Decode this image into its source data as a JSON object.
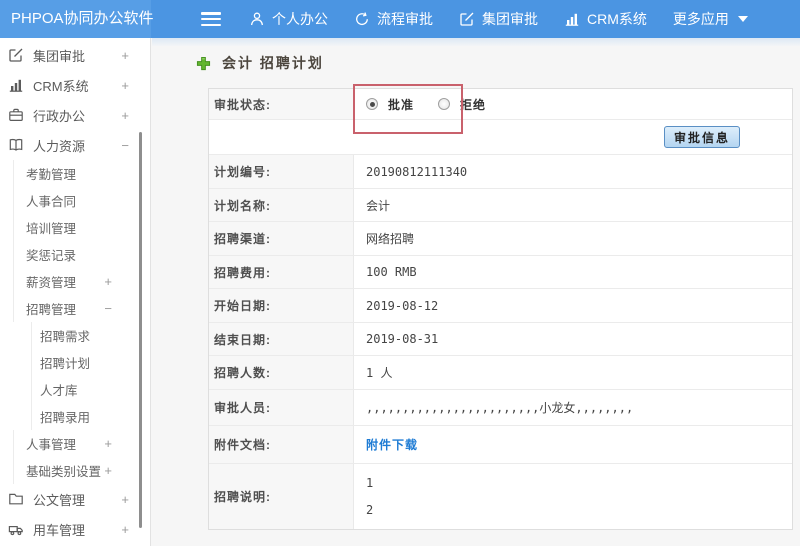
{
  "topbar": {
    "logo": "PHPOA协同办公软件",
    "nav": [
      {
        "name": "personal-office",
        "icon": "person-icon",
        "label": "个人办公"
      },
      {
        "name": "process-approval",
        "icon": "cycle-arrow-icon",
        "label": "流程审批"
      },
      {
        "name": "group-approval",
        "icon": "edit-square-icon",
        "label": "集团审批"
      },
      {
        "name": "crm-system",
        "icon": "bar-chart-icon",
        "label": "CRM系统"
      },
      {
        "name": "more-apps",
        "icon": "caret-down-icon",
        "label": "更多应用"
      }
    ]
  },
  "sidebar": {
    "items": [
      {
        "name": "group-approval",
        "level": 0,
        "icon": "edit-square-icon",
        "label": "集团审批",
        "toggle": "+"
      },
      {
        "name": "crm-system",
        "level": 0,
        "icon": "bar-chart-icon",
        "label": "CRM系统",
        "toggle": "+"
      },
      {
        "name": "admin-office",
        "level": 0,
        "icon": "briefcase-icon",
        "label": "行政办公",
        "toggle": "+"
      },
      {
        "name": "human-resources",
        "level": 0,
        "icon": "book-icon",
        "label": "人力资源",
        "toggle": "−"
      },
      {
        "name": "attendance-mgmt",
        "level": 1,
        "label": "考勤管理"
      },
      {
        "name": "personnel-contract",
        "level": 1,
        "label": "人事合同"
      },
      {
        "name": "training-mgmt",
        "level": 1,
        "label": "培训管理"
      },
      {
        "name": "reward-punishment",
        "level": 1,
        "label": "奖惩记录"
      },
      {
        "name": "salary-mgmt",
        "level": 1,
        "label": "薪资管理",
        "toggle": "+"
      },
      {
        "name": "recruit-mgmt",
        "level": 1,
        "label": "招聘管理",
        "toggle": "−"
      },
      {
        "name": "recruit-demand",
        "level": 2,
        "label": "招聘需求"
      },
      {
        "name": "recruit-plan",
        "level": 2,
        "label": "招聘计划"
      },
      {
        "name": "talent-pool",
        "level": 2,
        "label": "人才库"
      },
      {
        "name": "recruit-hiring",
        "level": 2,
        "label": "招聘录用"
      },
      {
        "name": "personnel-mgmt",
        "level": 1,
        "label": "人事管理",
        "toggle": "+"
      },
      {
        "name": "basic-category-settings",
        "level": 1,
        "label": "基础类别设置",
        "toggle": "+"
      },
      {
        "name": "document-mgmt",
        "level": 0,
        "icon": "folder-icon",
        "label": "公文管理",
        "toggle": "+"
      },
      {
        "name": "vehicle-mgmt",
        "level": 0,
        "icon": "truck-icon",
        "label": "用车管理",
        "toggle": "+"
      }
    ]
  },
  "main": {
    "title": "会计 招聘计划",
    "approval": {
      "label": "审批状态:",
      "options": [
        {
          "label": "批准",
          "checked": true
        },
        {
          "label": "拒绝",
          "checked": false
        }
      ],
      "button_label": "审批信息"
    },
    "fields": [
      {
        "name": "plan-number",
        "label": "计划编号:",
        "value": "20190812111340"
      },
      {
        "name": "plan-name",
        "label": "计划名称:",
        "value": "会计"
      },
      {
        "name": "recruit-channel",
        "label": "招聘渠道:",
        "value": "网络招聘"
      },
      {
        "name": "recruit-cost",
        "label": "招聘费用:",
        "value": "100 RMB"
      },
      {
        "name": "start-date",
        "label": "开始日期:",
        "value": "2019-08-12"
      },
      {
        "name": "end-date",
        "label": "结束日期:",
        "value": "2019-08-31"
      },
      {
        "name": "recruit-count",
        "label": "招聘人数:",
        "value": "1 人"
      },
      {
        "name": "approvers",
        "label": "审批人员:",
        "value": ",,,,,,,,,,,,,,,,,,,,,,,,小龙女,,,,,,,,"
      },
      {
        "name": "attachment",
        "label": "附件文档:",
        "value": "附件下载",
        "link": true
      },
      {
        "name": "recruit-description",
        "label": "招聘说明:",
        "lines": [
          "1",
          "2"
        ]
      }
    ]
  },
  "colors": {
    "topbar_blue": "#4b95e2",
    "logo_blue": "#579ee6",
    "link_blue": "#1f7cd4",
    "annotation_red": "#c9616c",
    "button_border_blue": "#5a8fc4",
    "plus_green": "#62b62f"
  }
}
